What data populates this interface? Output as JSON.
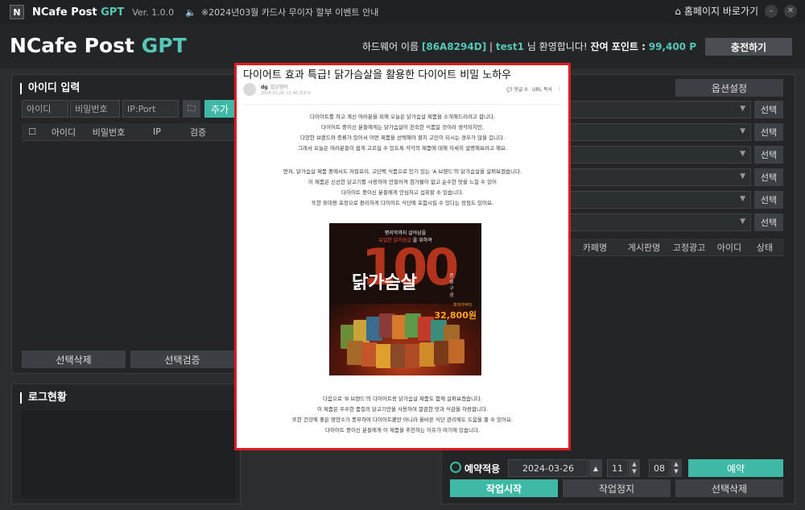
{
  "titlebar": {
    "logo_letter": "N",
    "app_name": "NCafe Post",
    "app_gpt": "GPT",
    "version": "Ver. 1.0.0",
    "notice": "※2024년03월 카드사 무이자 할부 이벤트 안내",
    "home_label": "홈페이지 바로가기"
  },
  "header": {
    "brand": "NCafe Post",
    "brand_gpt": "GPT",
    "hw_label": "하드웨어 이름",
    "hw_value": "[86A8294D]",
    "sep": "|",
    "user_id": "test1",
    "welcome": "님 환영합니다!",
    "points_label": "잔여 포인트 :",
    "points_value": "99,400 P",
    "charge_label": "충전하기"
  },
  "id_panel": {
    "title": "아이디 입력",
    "id_placeholder": "아이디",
    "pw_placeholder": "비밀번호",
    "proxy_placeholder": "IP:Port",
    "add_label": "추가",
    "columns": [
      "아이디",
      "비밀번호",
      "IP",
      "검증"
    ],
    "delete_label": "선택삭제",
    "verify_label": "선택검증"
  },
  "log_panel": {
    "title": "로그현황"
  },
  "right_panel": {
    "options_label": "옵션설정",
    "select_label": "선택",
    "columns": [
      "카페명",
      "게시판명",
      "고정광고",
      "아이디",
      "상태"
    ],
    "reserve_label": "예약적용",
    "reserve_date": "2024-03-26",
    "reserve_hour": "11",
    "reserve_min": "08",
    "reserve_btn": "예약",
    "start_label": "작업시작",
    "stop_label": "작업정지",
    "delete_label": "선택삭제"
  },
  "popup": {
    "title": "다이어트 효과 특급! 닭가슴살을 활용한 다이어트 비밀 노하우",
    "author": "dg",
    "author_level": "열심멤버",
    "date": "2024.03.26. 11:40  조회 0",
    "comments": "댓글 0",
    "url_copy": "URL 복사",
    "para1": [
      "다이어트를 하고 계신 여러분을 위해 오늘은 닭가슴살 제품을 소개해드리려고 합니다.",
      "다이어트 중이신 분들에게는 닭가슴살이 친숙한 식품일 것이라 생각되지만,",
      "다양한 브랜드와 종류가 있어서 어떤 제품을 선택해야 할지 고민이 되시는 경우가 많을 겁니다.",
      "그래서 오늘은 여러분들이 쉽게 고르실 수 있도록 각각의 제품에 대해 자세히 설명해보려고 해요."
    ],
    "para2": [
      "먼저, 닭가슴살 제품 중에서도 저칼로리, 고단백 식품으로 인기 있는 'A 브랜드'의 닭가슴살을 살펴보겠습니다.",
      "이 제품은 신선한 닭고기를 사용하여 만들어져 첨가물이 없고 순수한 맛을 느낄 수 있어",
      "다이어트 중이신 분들에게 안심하고 섭취할 수 있습니다.",
      "또한 휴대용 포장으로 편리하게 다이어트 식단에 포함시킬 수 있다는 장점도 있어요."
    ],
    "promo": {
      "line1": "평지막까지 살아남을",
      "line2": "유일한 닭가슴살",
      "line2b": "을 위하여",
      "number": "100",
      "main": "닭가슴살",
      "side": "종류",
      "side2": "구성",
      "price_tag": "최저가부터",
      "price": "32,800원"
    },
    "para3": [
      "다음으로 'B 브랜드'의 다이어트용 닭가슴살 제품도 함께 살펴보겠습니다.",
      "이 제품은 우수한 품질의 닭고기만을 사용하여 깔끔한 맛과 식감을 자랑합니다.",
      "또한 건강에 좋은 영양소가 풍부하여 다이어트뿐만 아니라 올바른 식단 관리에도 도움을 줄 수 있어요.",
      "다이어트 중이신 분들에게 이 제품을 추천하는 이유가 여기에 있습니다."
    ]
  },
  "colors": {
    "accent": "#3fb9a5",
    "popup_border": "#e01b22",
    "background": "#2b2d2f"
  }
}
